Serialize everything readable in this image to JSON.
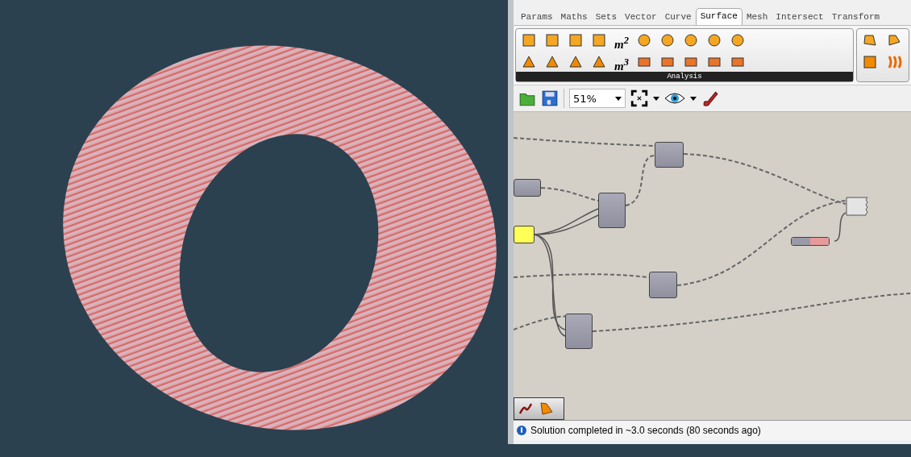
{
  "tabs": [
    {
      "label": "Params",
      "selected": false
    },
    {
      "label": "Maths",
      "selected": false
    },
    {
      "label": "Sets",
      "selected": false
    },
    {
      "label": "Vector",
      "selected": false
    },
    {
      "label": "Curve",
      "selected": false
    },
    {
      "label": "Surface",
      "selected": true
    },
    {
      "label": "Mesh",
      "selected": false
    },
    {
      "label": "Intersect",
      "selected": false
    },
    {
      "label": "Transform",
      "selected": false
    }
  ],
  "ribbon": {
    "group_label": "Analysis",
    "measure_labels": [
      "m$^{2}$",
      "m$^{3}$"
    ]
  },
  "toolbar": {
    "zoom": "51%"
  },
  "status_bar": {
    "message": "Solution completed in ~3.0 seconds (80 seconds ago)"
  }
}
